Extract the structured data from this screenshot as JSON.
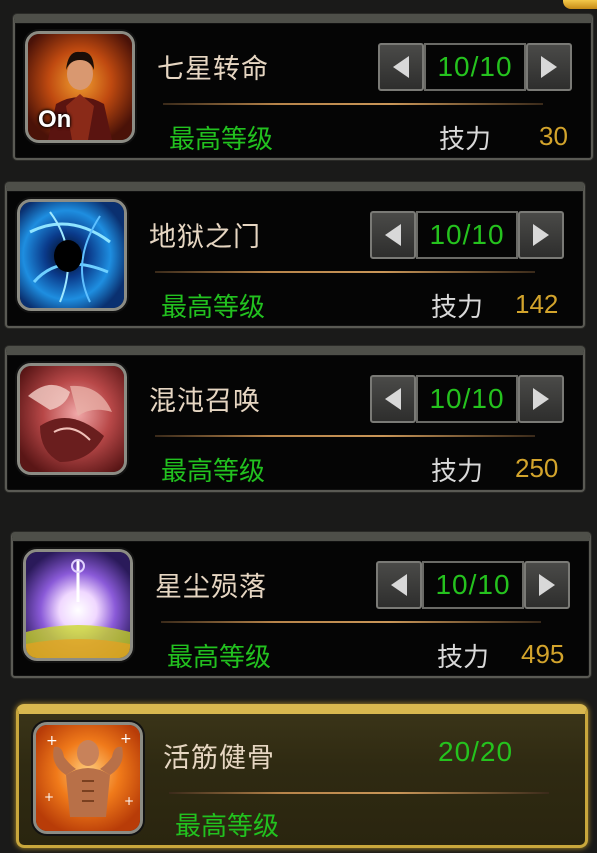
{
  "skills": [
    {
      "name": "七星转命",
      "level": "10/10",
      "max_label": "最高等级",
      "cost_label": "技力",
      "cost": "30",
      "on_badge": "On",
      "icon": "warrior-portrait-icon"
    },
    {
      "name": "地狱之门",
      "level": "10/10",
      "max_label": "最高等级",
      "cost_label": "技力",
      "cost": "142",
      "icon": "blue-vortex-icon"
    },
    {
      "name": "混沌召唤",
      "level": "10/10",
      "max_label": "最高等级",
      "cost_label": "技力",
      "cost": "250",
      "icon": "red-beast-icon"
    },
    {
      "name": "星尘殒落",
      "level": "10/10",
      "max_label": "最高等级",
      "cost_label": "技力",
      "cost": "495",
      "icon": "stardust-burst-icon"
    },
    {
      "name": "活筋健骨",
      "level": "20/20",
      "max_label": "最高等级",
      "icon": "muscle-man-icon"
    }
  ],
  "colors": {
    "green": "#25c21e",
    "gold": "#d3a42c",
    "name": "#e6d6c2",
    "highlight_border": "#c9a73c"
  }
}
